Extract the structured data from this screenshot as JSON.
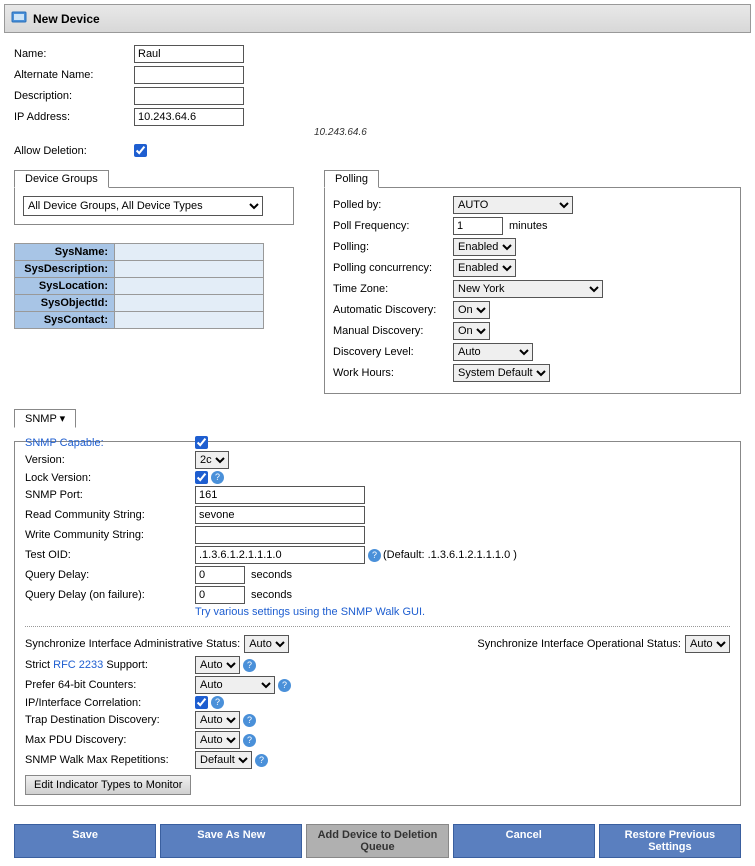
{
  "title": "New Device",
  "basic": {
    "name_label": "Name:",
    "name_value": "Raul",
    "altname_label": "Alternate Name:",
    "altname_value": "",
    "desc_label": "Description:",
    "desc_value": "",
    "ip_label": "IP Address:",
    "ip_value": "10.243.64.6",
    "ip_hint": "10.243.64.6",
    "allow_deletion_label": "Allow Deletion:"
  },
  "device_groups": {
    "tab": "Device Groups",
    "selected": "All Device Groups, All Device Types"
  },
  "sys": {
    "name": "SysName:",
    "desc": "SysDescription:",
    "loc": "SysLocation:",
    "obj": "SysObjectId:",
    "contact": "SysContact:"
  },
  "polling": {
    "tab": "Polling",
    "polled_by_label": "Polled by:",
    "polled_by": "AUTO",
    "freq_label": "Poll Frequency:",
    "freq_value": "1",
    "freq_unit": "minutes",
    "polling_label": "Polling:",
    "polling": "Enabled",
    "concurrency_label": "Polling concurrency:",
    "concurrency": "Enabled",
    "tz_label": "Time Zone:",
    "tz": "New York",
    "auto_disc_label": "Automatic Discovery:",
    "auto_disc": "On",
    "manual_disc_label": "Manual Discovery:",
    "manual_disc": "On",
    "disc_level_label": "Discovery Level:",
    "disc_level": "Auto",
    "work_hours_label": "Work Hours:",
    "work_hours": "System Default"
  },
  "snmp": {
    "tab": "SNMP",
    "capable_label": "SNMP Capable:",
    "version_label": "Version:",
    "version": "2c",
    "lock_label": "Lock Version:",
    "port_label": "SNMP Port:",
    "port": "161",
    "read_label": "Read Community String:",
    "read": "sevone",
    "write_label": "Write Community String:",
    "write": "",
    "oid_label": "Test OID:",
    "oid": ".1.3.6.1.2.1.1.1.0",
    "oid_default": "(Default: .1.3.6.1.2.1.1.1.0 )",
    "qdelay_label": "Query Delay:",
    "qdelay": "0",
    "qdelay_unit": "seconds",
    "qdelayf_label": "Query Delay (on failure):",
    "qdelayf": "0",
    "qdelayf_unit": "seconds",
    "walk_link": "Try various settings using the SNMP Walk GUI.",
    "sync_admin_label": "Synchronize Interface Administrative Status:",
    "sync_admin": "Auto",
    "sync_oper_label": "Synchronize Interface Operational Status:",
    "sync_oper": "Auto",
    "rfc_pre": "Strict ",
    "rfc_link": "RFC 2233",
    "rfc_post": " Support:",
    "rfc": "Auto",
    "p64_label": "Prefer 64-bit Counters:",
    "p64": "Auto",
    "ipcorr_label": "IP/Interface Correlation:",
    "trap_label": "Trap Destination Discovery:",
    "trap": "Auto",
    "pdu_label": "Max PDU Discovery:",
    "pdu": "Auto",
    "maxrep_label": "SNMP Walk Max Repetitions:",
    "maxrep": "Default",
    "edit_indicators": "Edit Indicator Types to Monitor"
  },
  "buttons": {
    "save": "Save",
    "save_as_new": "Save As New",
    "add_queue": "Add Device to Deletion Queue",
    "cancel": "Cancel",
    "restore": "Restore Previous Settings"
  }
}
